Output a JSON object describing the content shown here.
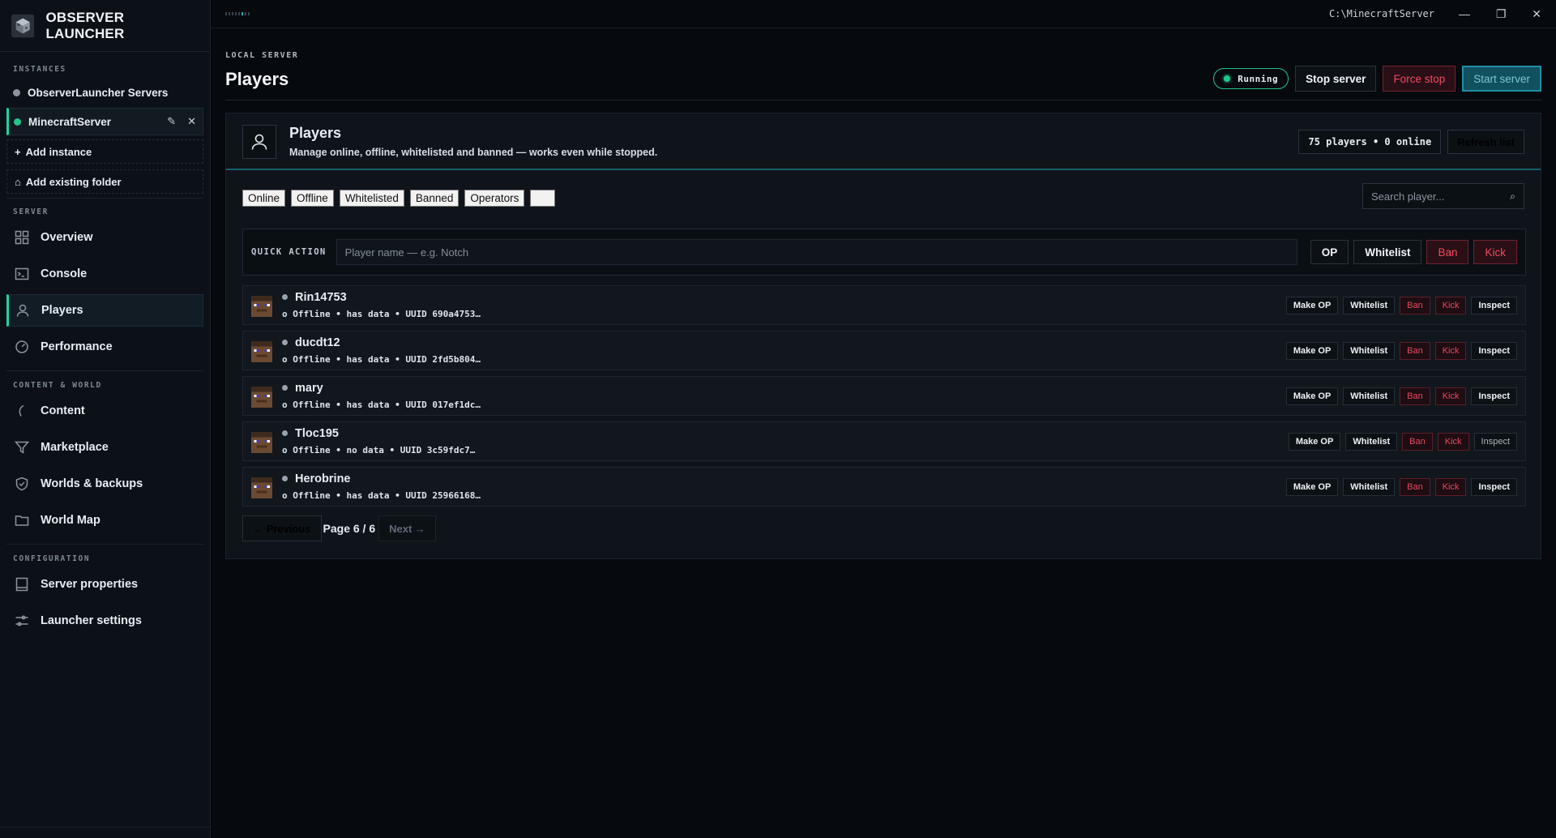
{
  "brand": {
    "title": "OBSERVER LAUNCHER",
    "logo_icon": "cube-logo-icon"
  },
  "sidebar": {
    "instances_label": "INSTANCES",
    "instances": [
      {
        "name": "ObserverLauncher Servers",
        "status": "stopped"
      },
      {
        "name": "MinecraftServer",
        "status": "running"
      }
    ],
    "add_instance": "Add instance",
    "add_existing": "Add existing folder",
    "server_label": "SERVER",
    "server_items": [
      "Overview",
      "Console",
      "Players",
      "Performance"
    ],
    "content_label": "CONTENT & WORLD",
    "content_items": [
      "Content",
      "Marketplace",
      "Worlds & backups",
      "World Map"
    ],
    "config_label": "CONFIGURATION",
    "config_items": [
      "Server properties",
      "Launcher settings"
    ],
    "active_item": "Players"
  },
  "titlebar": {
    "path": "C:\\MinecraftServer"
  },
  "header": {
    "kicker": "LOCAL SERVER",
    "title": "Players",
    "status": "Running",
    "stop": "Stop server",
    "force_stop": "Force stop",
    "start": "Start server"
  },
  "panel": {
    "title": "Players",
    "subtitle": "Manage online, offline, whitelisted and banned — works even while stopped.",
    "count": "75 players • 0 online",
    "refresh": "Refresh list",
    "filters": [
      "Online",
      "Offline",
      "Whitelisted",
      "Banned",
      "Operators",
      ""
    ],
    "search_placeholder": "Search player...",
    "quick_label": "QUICK ACTION",
    "quick_placeholder": "Player name — e.g. Notch",
    "quick_buttons": {
      "op": "OP",
      "whitelist": "Whitelist",
      "ban": "Ban",
      "kick": "Kick"
    }
  },
  "players": [
    {
      "name": "Rin14753",
      "meta": "o Offline • has data • UUID 690a4753…"
    },
    {
      "name": "ducdt12",
      "meta": "o Offline • has data • UUID 2fd5b804…"
    },
    {
      "name": "mary",
      "meta": "o Offline • has data • UUID 017ef1dc…"
    },
    {
      "name": "Tloc195",
      "meta": "o Offline • no data • UUID 3c59fdc7…"
    },
    {
      "name": "Herobrine",
      "meta": "o Offline • has data • UUID 25966168…"
    }
  ],
  "row_actions": {
    "make_op": "Make OP",
    "whitelist": "Whitelist",
    "ban": "Ban",
    "kick": "Kick",
    "inspect": "Inspect"
  },
  "pager": {
    "prev": "← Previous",
    "info": "Page 6 / 6",
    "next": "Next →"
  },
  "colors": {
    "accent": "#22d3a6",
    "running": "#22c58b",
    "danger": "#f04a60",
    "teal": "#1e8fa5"
  }
}
